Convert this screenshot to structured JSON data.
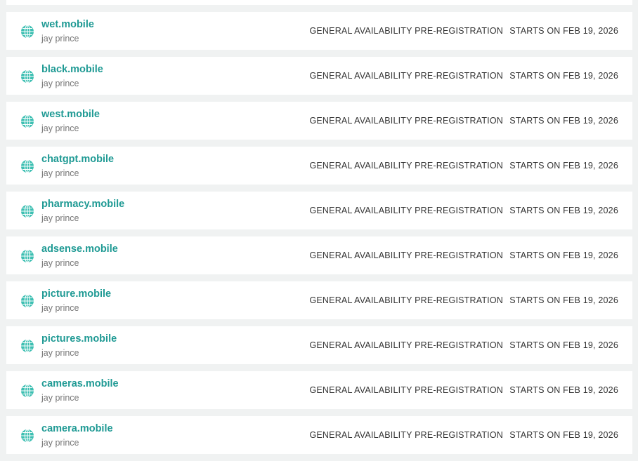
{
  "colors": {
    "background": "#f0f2f2",
    "row_background": "#ffffff",
    "domain_link": "#1f9a94",
    "globe_fill": "#3dbfb2",
    "owner_text": "#777777",
    "status_text": "#333333"
  },
  "icons": {
    "domain_icon": "globe-icon"
  },
  "domains": [
    {
      "name": "wet.mobile",
      "owner": "jay prince",
      "phase": "GENERAL AVAILABILITY PRE-REGISTRATION",
      "starts": "STARTS ON FEB 19, 2026"
    },
    {
      "name": "black.mobile",
      "owner": "jay prince",
      "phase": "GENERAL AVAILABILITY PRE-REGISTRATION",
      "starts": "STARTS ON FEB 19, 2026"
    },
    {
      "name": "west.mobile",
      "owner": "jay prince",
      "phase": "GENERAL AVAILABILITY PRE-REGISTRATION",
      "starts": "STARTS ON FEB 19, 2026"
    },
    {
      "name": "chatgpt.mobile",
      "owner": "jay prince",
      "phase": "GENERAL AVAILABILITY PRE-REGISTRATION",
      "starts": "STARTS ON FEB 19, 2026"
    },
    {
      "name": "pharmacy.mobile",
      "owner": "jay prince",
      "phase": "GENERAL AVAILABILITY PRE-REGISTRATION",
      "starts": "STARTS ON FEB 19, 2026"
    },
    {
      "name": "adsense.mobile",
      "owner": "jay prince",
      "phase": "GENERAL AVAILABILITY PRE-REGISTRATION",
      "starts": "STARTS ON FEB 19, 2026"
    },
    {
      "name": "picture.mobile",
      "owner": "jay prince",
      "phase": "GENERAL AVAILABILITY PRE-REGISTRATION",
      "starts": "STARTS ON FEB 19, 2026"
    },
    {
      "name": "pictures.mobile",
      "owner": "jay prince",
      "phase": "GENERAL AVAILABILITY PRE-REGISTRATION",
      "starts": "STARTS ON FEB 19, 2026"
    },
    {
      "name": "cameras.mobile",
      "owner": "jay prince",
      "phase": "GENERAL AVAILABILITY PRE-REGISTRATION",
      "starts": "STARTS ON FEB 19, 2026"
    },
    {
      "name": "camera.mobile",
      "owner": "jay prince",
      "phase": "GENERAL AVAILABILITY PRE-REGISTRATION",
      "starts": "STARTS ON FEB 19, 2026"
    }
  ]
}
